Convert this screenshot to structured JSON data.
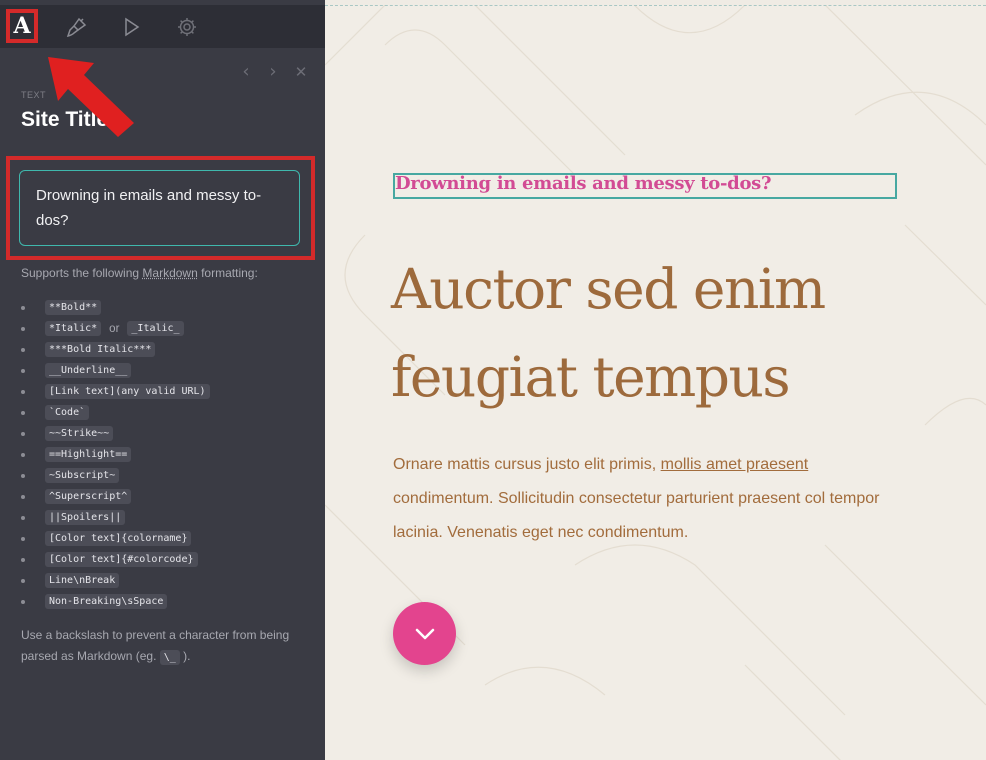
{
  "toolbar": {
    "tools": [
      {
        "name": "text",
        "label": "A",
        "icon": "text-icon",
        "active": true
      },
      {
        "name": "design",
        "icon": "paintbrush-icon"
      },
      {
        "name": "preview",
        "icon": "play-icon"
      },
      {
        "name": "settings",
        "icon": "gear-icon"
      }
    ],
    "nav": {
      "prev": "‹",
      "next": "›",
      "close": "✕"
    }
  },
  "panel": {
    "kicker": "TEXT",
    "title": "Site Title",
    "input_value": "Drowning in emails and messy to-dos?",
    "md_intro_prefix": "Supports the following ",
    "md_intro_link": "Markdown",
    "md_intro_suffix": " formatting:",
    "md_items": [
      "**Bold**",
      "*Italic*",
      "_Italic_",
      "***Bold Italic***",
      "__Underline__",
      "[Link text](any valid URL)",
      "`Code`",
      "~~Strike~~",
      "==Highlight==",
      "~Subscript~",
      "^Superscript^",
      "||Spoilers||",
      "[Color text]{colorname}",
      "[Color text]{#colorcode}",
      "Line\\nBreak",
      "Non-Breaking\\sSpace"
    ],
    "or_label": "or",
    "backslash_prefix": "Use a backslash to prevent a character from being parsed as Markdown (eg. ",
    "backslash_code": "\\_",
    "backslash_suffix": " )."
  },
  "preview": {
    "kicker": "Drowning in emails and messy to-dos?",
    "heading": "Auctor sed enim feugiat tempus",
    "body_prefix": "Ornare mattis cursus justo elit primis, ",
    "body_link": "mollis amet praesent",
    "body_suffix": " condimentum. Sollicitudin consectetur parturient praesent col tempor lacinia. Venenatis eget nec condimentum.",
    "scroll_icon": "chevron-down-icon"
  },
  "colors": {
    "sidebar_bg": "#3a3b44",
    "accent_teal": "#3fb8ad",
    "kicker_pink": "#d24b94",
    "heading_brown": "#9d6a3c",
    "button_pink": "#e3448e",
    "annotation_red": "#d42a2a"
  }
}
